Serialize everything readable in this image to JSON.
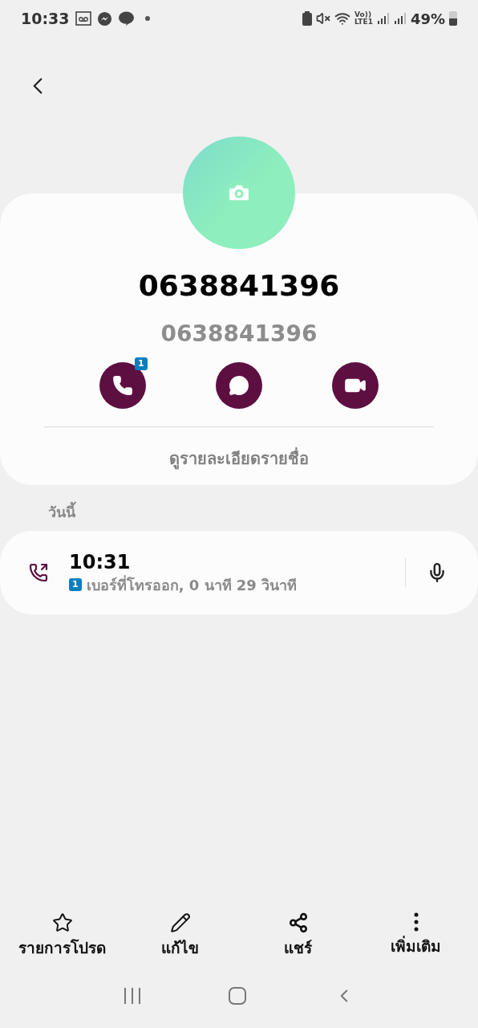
{
  "status_bar": {
    "time": "10:33",
    "volte": [
      "Vo))",
      "LTE1"
    ],
    "battery": "49%"
  },
  "contact": {
    "name": "0638841396",
    "number": "0638841396"
  },
  "actions": [
    {
      "kind": "call",
      "badge": "1"
    },
    {
      "kind": "message"
    },
    {
      "kind": "video"
    }
  ],
  "details_link": "ดูรายละเอียดรายชื่อ",
  "section_label": "วันนี้",
  "call_log": [
    {
      "kind": "outgoing",
      "time": "10:31",
      "sim": "1",
      "description": "เบอร์ที่โทรออก, 0 นาที 29 วินาที"
    }
  ],
  "bottom_actions": [
    {
      "kind": "favorite",
      "label": "รายการโปรด"
    },
    {
      "kind": "edit",
      "label": "แก้ไข"
    },
    {
      "kind": "share",
      "label": "แชร์"
    },
    {
      "kind": "more",
      "label": "เพิ่มเติม"
    }
  ]
}
